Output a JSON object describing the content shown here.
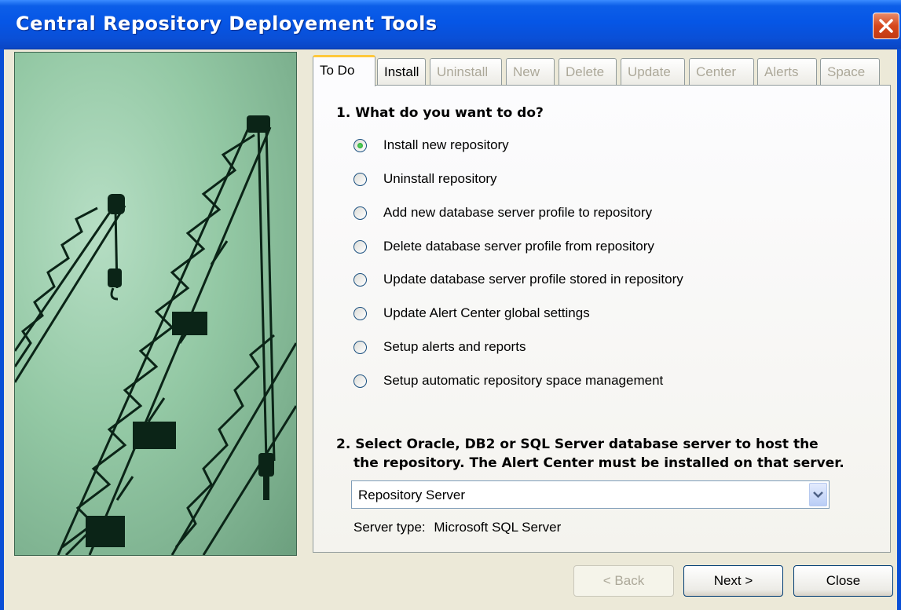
{
  "window": {
    "title": "Central Repository Deployement Tools"
  },
  "tabs": [
    {
      "label": "To Do",
      "state": "active"
    },
    {
      "label": "Install",
      "state": "enabled"
    },
    {
      "label": "Uninstall",
      "state": "disabled"
    },
    {
      "label": "New",
      "state": "disabled"
    },
    {
      "label": "Delete",
      "state": "disabled"
    },
    {
      "label": "Update",
      "state": "disabled"
    },
    {
      "label": "Center",
      "state": "disabled"
    },
    {
      "label": "Alerts",
      "state": "disabled"
    },
    {
      "label": "Space",
      "state": "disabled"
    }
  ],
  "section1": {
    "heading": "1. What do you want to do?",
    "options": [
      {
        "label": "Install new repository",
        "checked": true
      },
      {
        "label": "Uninstall repository",
        "checked": false
      },
      {
        "label": "Add new database server profile to repository",
        "checked": false
      },
      {
        "label": "Delete database server profile from repository",
        "checked": false
      },
      {
        "label": "Update database server profile stored in repository",
        "checked": false
      },
      {
        "label": "Update Alert Center global settings",
        "checked": false
      },
      {
        "label": "Setup alerts and reports",
        "checked": false
      },
      {
        "label": "Setup automatic repository space management",
        "checked": false
      }
    ]
  },
  "section2": {
    "heading_line1": "2. Select Oracle, DB2 or SQL Server database server to host the",
    "heading_line2": "the repository. The Alert Center must be installed on that server.",
    "server_select_value": "Repository Server",
    "server_type_label": "Server type:",
    "server_type_value": "Microsoft SQL Server"
  },
  "buttons": {
    "back": "< Back",
    "next": "Next >",
    "close": "Close"
  },
  "colors": {
    "title_bar": "#0a4fd6",
    "dialog_bg": "#ece9d8",
    "active_tab_highlight": "#ffc83c",
    "image_tint": "#93c8a4"
  },
  "icons": {
    "close": "close-x-icon",
    "dropdown": "chevron-down-icon",
    "image": "construction-cranes-image"
  }
}
